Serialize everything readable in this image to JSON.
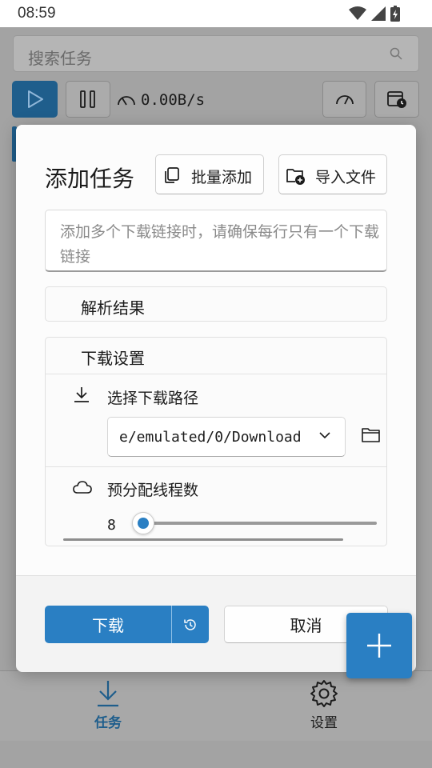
{
  "status_bar": {
    "time": "08:59"
  },
  "background": {
    "search_placeholder": "搜索任务",
    "speed": "0.00B/s"
  },
  "dialog": {
    "title": "添加任务",
    "batch_add_label": "批量添加",
    "import_file_label": "导入文件",
    "url_placeholder": "添加多个下载链接时，请确保每行只有一个下载链接",
    "parse_result_label": "解析结果",
    "download_settings_label": "下载设置",
    "download_path_label": "选择下载路径",
    "download_path_value": "e/emulated/0/Download",
    "thread_count_label": "预分配线程数",
    "thread_count_value": "8",
    "download_button": "下载",
    "cancel_button": "取消"
  },
  "bottom_nav": {
    "tasks_label": "任务",
    "settings_label": "设置"
  },
  "colors": {
    "accent": "#2a7fc3",
    "accent_dark": "#1f5e8c"
  }
}
